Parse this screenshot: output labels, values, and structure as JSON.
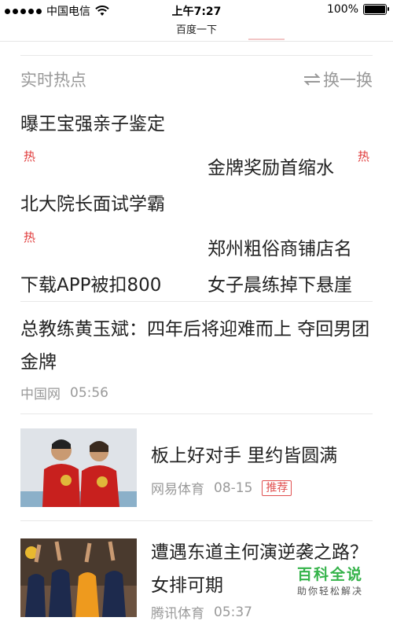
{
  "status": {
    "carrier": "中国电信",
    "time": "上午7:27",
    "battery": "100%"
  },
  "page_title": "百度一下",
  "hot": {
    "header": "实时热点",
    "refresh_label": "换一换",
    "badge": "热",
    "items": [
      "曝王宝强亲子鉴定",
      "金牌奖励首缩水",
      "北大院长面试学霸",
      "郑州粗俗商铺店名",
      "下载APP被扣800",
      "女子晨练掉下悬崖"
    ]
  },
  "news": [
    {
      "title": "总教练黄玉斌：四年后将迎难而上 夺回男团金牌",
      "source": "中国网",
      "time": "05:56"
    },
    {
      "title": "板上好对手 里约皆圆满",
      "source": "网易体育",
      "time": "08-15",
      "tag": "推荐"
    },
    {
      "title": "遭遇东道主何演逆袭之路？女排可期",
      "source": "腾讯体育",
      "time": "05:37"
    }
  ],
  "watermark": {
    "title": "百科全说",
    "subtitle": "助你轻松解决"
  }
}
